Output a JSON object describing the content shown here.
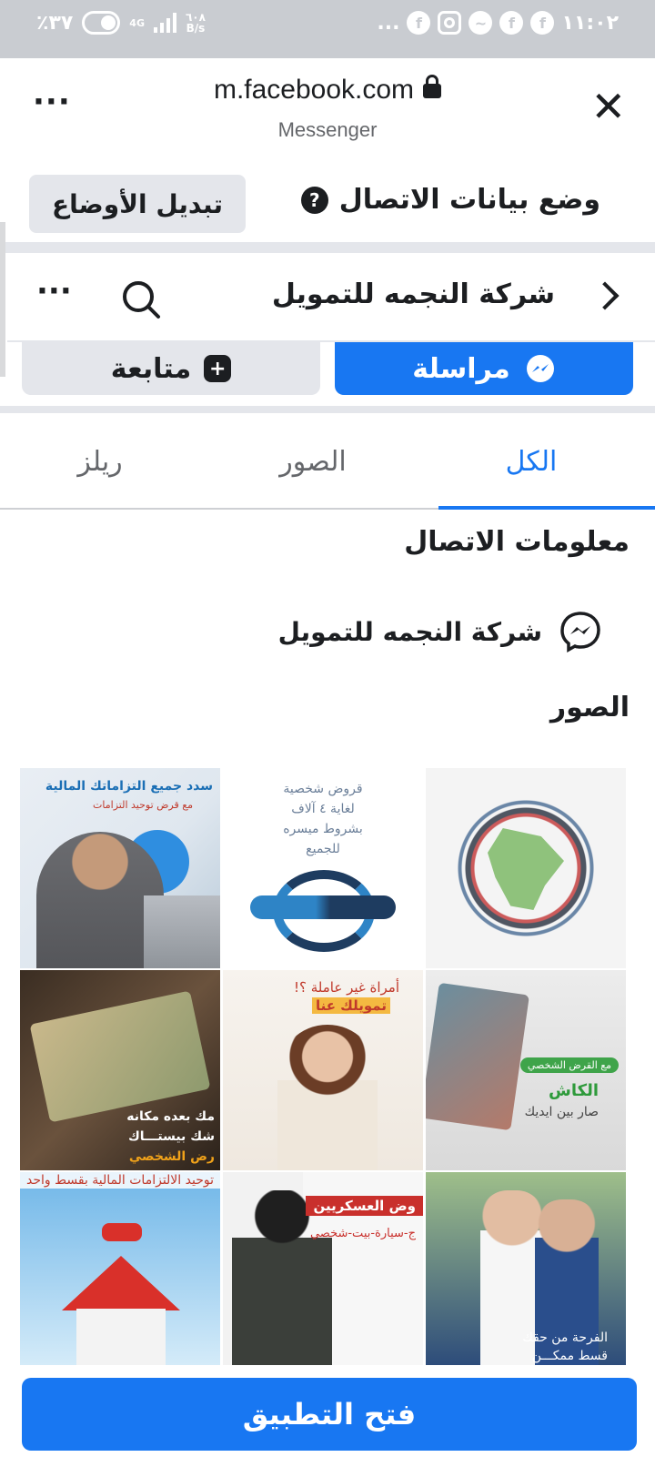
{
  "status_bar": {
    "battery": "٪٣٧",
    "network": "4G",
    "speed_value": "٦٠٨",
    "speed_unit": "B/s",
    "notification_dots": "...",
    "time": "١١:٠٢"
  },
  "browser": {
    "url": "m.facebook.com",
    "subtitle": "Messenger"
  },
  "mode_bar": {
    "toggle_label": "تبديل الأوضاع",
    "contact_mode_label": "وضع بيانات الاتصال"
  },
  "page_header": {
    "title": "شركة النجمه للتمويل"
  },
  "actions": {
    "follow_label": "متابعة",
    "message_label": "مراسلة"
  },
  "tabs": [
    {
      "label": "الكل",
      "active": true
    },
    {
      "label": "الصور",
      "active": false
    },
    {
      "label": "ريلز",
      "active": false
    }
  ],
  "contact_info": {
    "title": "معلومات الاتصال",
    "messenger_name": "شركة النجمه للتمويل"
  },
  "photos_section": {
    "title": "الصور",
    "photos": [
      {
        "caption_1": "سدد جميع التزاماتك المالية",
        "caption_2": "مع قرض توحيد التزامات"
      },
      {
        "caption_1": "قروض شخصية",
        "caption_2": "لغاية ٤ آلاف",
        "caption_3": "بشروط ميسره",
        "caption_4": "للجميع"
      },
      {},
      {
        "caption_1": "مك بعده مكانه",
        "caption_2": "شك بيستـــاك",
        "caption_3": "رض الشخصي"
      },
      {
        "caption_1": "أمراة غير عاملة ؟!",
        "caption_2": "تمويلك عنا"
      },
      {
        "caption_1": "مع القرض الشخصي",
        "caption_2": "الكاش",
        "caption_3": "صار بين ايديك"
      },
      {
        "caption_1": "توحيد الالتزامات المالية بقسط واحد"
      },
      {
        "caption_1": "وض العسكريين",
        "caption_2": "ج-سيارة-بيت-شخصي"
      },
      {
        "caption_1": "الفرحة من حقك",
        "caption_2": "قسط ممكـــن"
      }
    ]
  },
  "bottom": {
    "open_app_label": "فتح التطبيق"
  },
  "colors": {
    "accent": "#1877f2",
    "status_bar": "#c9ccd1",
    "secondary_button": "#e4e6eb"
  }
}
